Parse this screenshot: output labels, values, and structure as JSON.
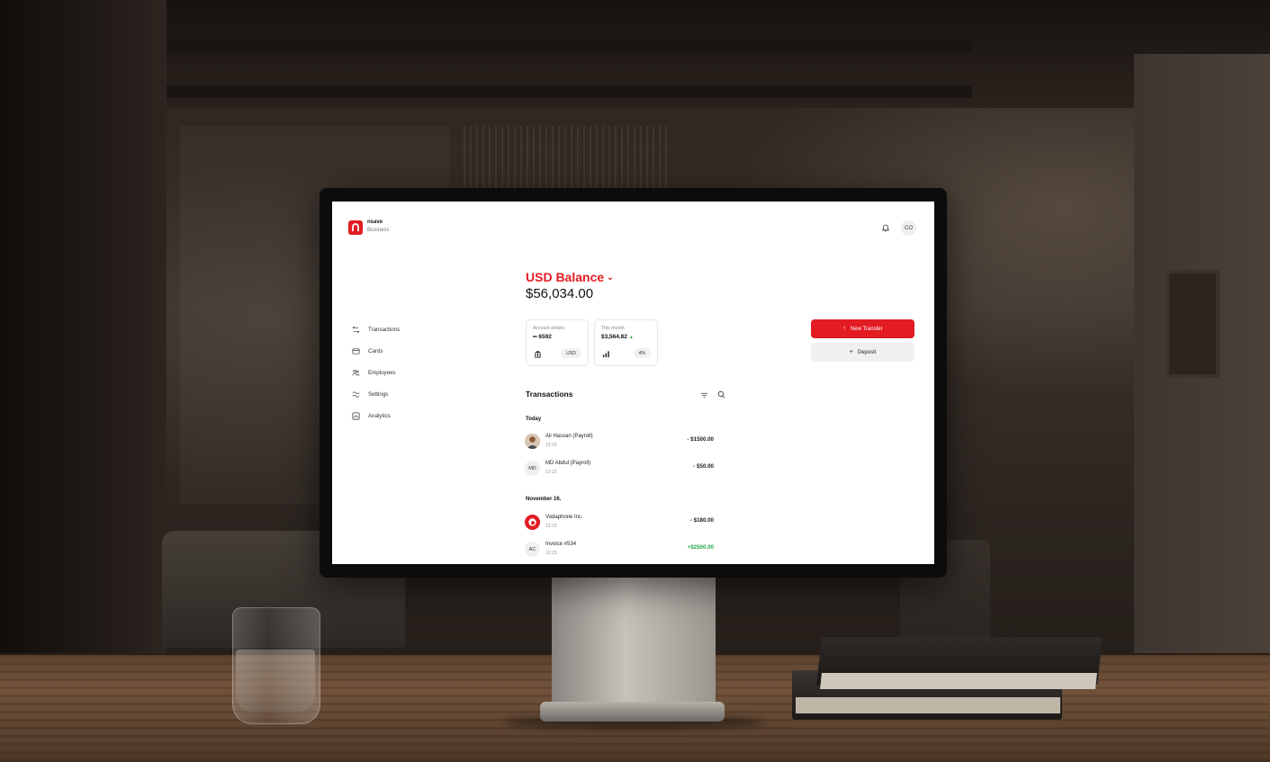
{
  "app": {
    "brand_name": "nsave",
    "brand_sub": "Business",
    "user_initials": "CO"
  },
  "nav": {
    "items": [
      {
        "label": "Transactions",
        "icon": "transfer-arrows-icon"
      },
      {
        "label": "Cards",
        "icon": "card-icon"
      },
      {
        "label": "Employees",
        "icon": "users-icon"
      },
      {
        "label": "Settings",
        "icon": "settings-icon"
      },
      {
        "label": "Analytics",
        "icon": "analytics-icon"
      }
    ]
  },
  "balance": {
    "title": "USD Balance",
    "amount": "$56,034.00"
  },
  "account_card": {
    "label": "Account details",
    "number": "•• 6592",
    "currency": "USD",
    "icon": "bank-icon"
  },
  "month_card": {
    "label": "This month",
    "amount": "$3,564.82",
    "change": "4%",
    "icon": "bar-chart-icon"
  },
  "actions": {
    "new_transfer": "New Transfer",
    "deposit": "Deposit"
  },
  "transactions": {
    "title": "Transactions",
    "groups": [
      {
        "label": "Today",
        "items": [
          {
            "name": "Ali Hassan (Payroll)",
            "time": "12:23",
            "amount": "- $1500.00",
            "avatar": "",
            "positive": false
          },
          {
            "name": "MD Abdul (Payroll)",
            "time": "12:23",
            "amount": "- $50.00",
            "avatar": "MD",
            "positive": false
          }
        ]
      },
      {
        "label": "November 16.",
        "items": [
          {
            "name": "Vodaphone Inc.",
            "time": "12:23",
            "amount": "- $180.00",
            "avatar": "",
            "positive": false
          },
          {
            "name": "Invoice #534",
            "time": "12:23",
            "amount": "+$2500.00",
            "avatar": "AC",
            "positive": true
          }
        ]
      }
    ]
  },
  "colors": {
    "brand_red": "#e31b23",
    "positive_green": "#27a84a"
  }
}
